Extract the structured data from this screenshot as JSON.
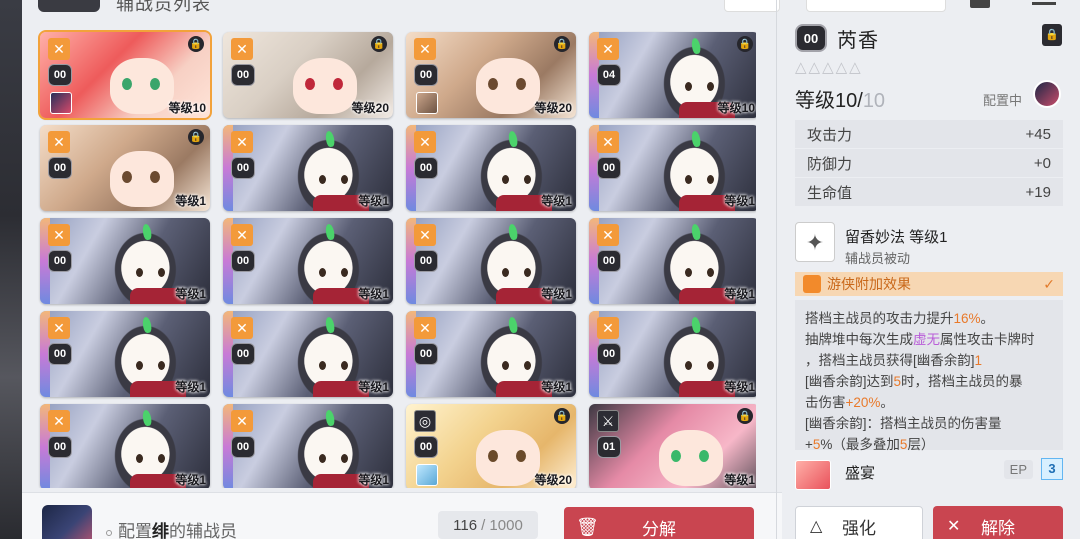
{
  "header": {
    "title": "辅战员列表"
  },
  "cards": [
    {
      "type": "girl-red",
      "rarity": "X",
      "tag": "00",
      "level": "等级10",
      "locked": true,
      "avatar": "red",
      "selected": true
    },
    {
      "type": "girl-silver",
      "rarity": "X",
      "tag": "00",
      "level": "等级20",
      "locked": true,
      "avatar": "",
      "selected": false
    },
    {
      "type": "girl-brown",
      "rarity": "X",
      "tag": "00",
      "level": "等级20",
      "locked": true,
      "avatar": "brown",
      "selected": false
    },
    {
      "type": "bunny",
      "rarity": "X",
      "tag": "04",
      "level": "等级10",
      "locked": true,
      "avatar": "",
      "selected": false
    },
    {
      "type": "girl-brown",
      "rarity": "X",
      "tag": "00",
      "level": "等级1",
      "locked": true,
      "avatar": "",
      "selected": false
    },
    {
      "type": "bunny",
      "rarity": "X",
      "tag": "00",
      "level": "等级1",
      "locked": false,
      "avatar": "",
      "selected": false
    },
    {
      "type": "bunny",
      "rarity": "X",
      "tag": "00",
      "level": "等级1",
      "locked": false,
      "avatar": "",
      "selected": false
    },
    {
      "type": "bunny",
      "rarity": "X",
      "tag": "00",
      "level": "等级1",
      "locked": false,
      "avatar": "",
      "selected": false
    },
    {
      "type": "bunny",
      "rarity": "X",
      "tag": "00",
      "level": "等级1",
      "locked": false,
      "avatar": "",
      "selected": false
    },
    {
      "type": "bunny",
      "rarity": "X",
      "tag": "00",
      "level": "等级1",
      "locked": false,
      "avatar": "",
      "selected": false
    },
    {
      "type": "bunny",
      "rarity": "X",
      "tag": "00",
      "level": "等级1",
      "locked": false,
      "avatar": "",
      "selected": false
    },
    {
      "type": "bunny",
      "rarity": "X",
      "tag": "00",
      "level": "等级1",
      "locked": false,
      "avatar": "",
      "selected": false
    },
    {
      "type": "bunny",
      "rarity": "X",
      "tag": "00",
      "level": "等级1",
      "locked": false,
      "avatar": "",
      "selected": false
    },
    {
      "type": "bunny",
      "rarity": "X",
      "tag": "00",
      "level": "等级1",
      "locked": false,
      "avatar": "",
      "selected": false
    },
    {
      "type": "bunny",
      "rarity": "X",
      "tag": "00",
      "level": "等级1",
      "locked": false,
      "avatar": "",
      "selected": false
    },
    {
      "type": "bunny",
      "rarity": "X",
      "tag": "00",
      "level": "等级1",
      "locked": false,
      "avatar": "",
      "selected": false
    },
    {
      "type": "bunny",
      "rarity": "X",
      "tag": "00",
      "level": "等级1",
      "locked": false,
      "avatar": "",
      "selected": false
    },
    {
      "type": "bunny",
      "rarity": "X",
      "tag": "00",
      "level": "等级1",
      "locked": false,
      "avatar": "",
      "selected": false
    },
    {
      "type": "girl-blond",
      "rarity": "◎",
      "tag": "00",
      "level": "等级20",
      "locked": true,
      "avatar": "blue",
      "selected": false
    },
    {
      "type": "girl-pink",
      "rarity": "⚔",
      "tag": "01",
      "level": "等级1",
      "locked": true,
      "avatar": "",
      "selected": false
    }
  ],
  "footer": {
    "assign_prefix": "配置",
    "assign_name": "绯",
    "assign_suffix": "的辅战员",
    "count_current": "116",
    "count_total": "/ 1000",
    "dismantle_label": "分解"
  },
  "details": {
    "tag": "00",
    "name": "芮香",
    "stars": "△△△△△",
    "level_current": "等级10/",
    "level_max": "10",
    "equipped_label": "配置中",
    "stats": [
      {
        "label": "攻击力",
        "value": "+45"
      },
      {
        "label": "防御力",
        "value": "+0"
      },
      {
        "label": "生命值",
        "value": "+19"
      }
    ],
    "skill_name": "留香妙法 等级1",
    "skill_sub": "辅战员被动",
    "bonus_label": "游侠附加效果",
    "desc": {
      "l1a": "搭档主战员的攻击力提升",
      "l1b": "16%",
      "l1c": "。",
      "l2a": "抽牌堆中每次生成",
      "l2b": "虚无",
      "l2c": "属性攻击卡牌时",
      "l3a": "，搭档主战员获得[幽香余韵]",
      "l3b": "1",
      "l4a": "[幽香余韵]达到",
      "l4b": "5",
      "l4c": "时，搭档主战员的暴",
      "l5a": "击伤害",
      "l5b": "+20%",
      "l5c": "。",
      "l6a": "[幽香余韵]：搭档主战员的伤害量",
      "l7a": "+",
      "l7b": "5",
      "l7c": "%（最多叠加",
      "l7d": "5",
      "l7e": "层）"
    },
    "ally_name": "盛宴",
    "ep_label": "EP",
    "ep_value": "3",
    "upgrade_label": "强化",
    "unequip_label": "解除"
  }
}
